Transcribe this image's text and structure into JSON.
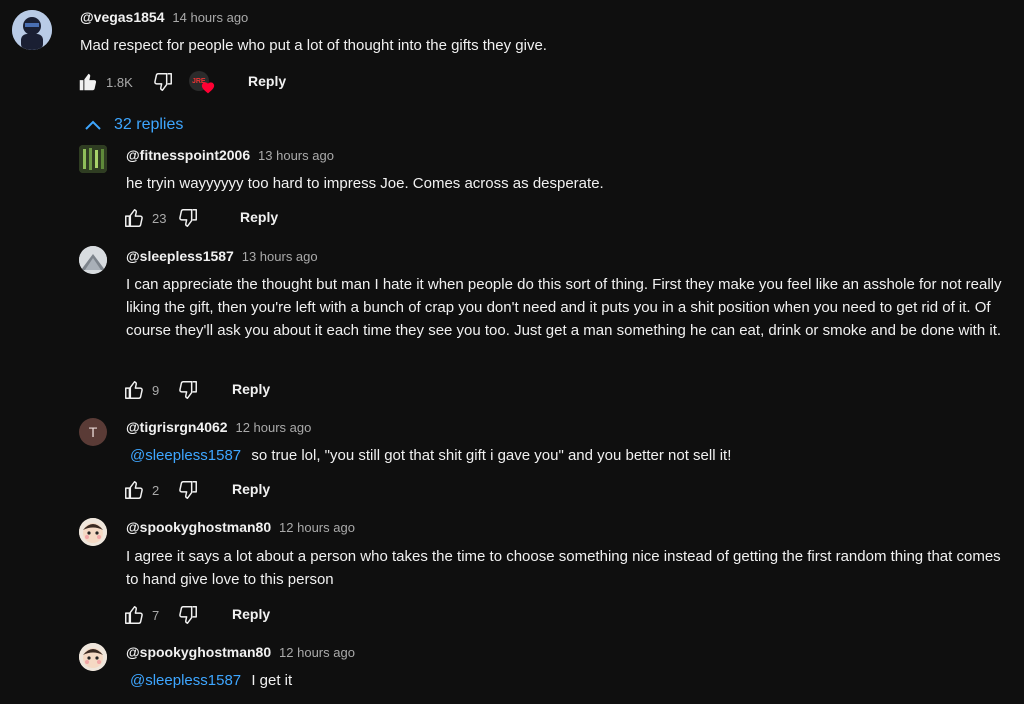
{
  "top_comment": {
    "author": "@vegas1854",
    "time": "14 hours ago",
    "text": "Mad respect for people who put a lot of thought into the gifts they give.",
    "likes": "1.8K",
    "reply_label": "Reply",
    "creator_heart_badge": "JRE"
  },
  "replies_toggle": {
    "label": "32 replies",
    "icon": "chevron-up-icon"
  },
  "replies": [
    {
      "author": "@fitnesspoint2006",
      "time": "13 hours ago",
      "text": "he tryin wayyyyyy too hard to impress Joe.  Comes across as desperate.",
      "likes": "23",
      "reply_label": "Reply"
    },
    {
      "author": "@sleepless1587",
      "time": "13 hours ago",
      "text": "I can appreciate the thought but man I hate it when people do this sort of thing. First they make you feel like an asshole for not really liking the gift, then you're left with a bunch of crap you don't need and it puts you in a shit position when you need to get rid of it. Of course they'll ask you about it each time they see you too. Just get a man something he can eat, drink or smoke and be done with it.",
      "likes": "9",
      "reply_label": "Reply"
    },
    {
      "author": "@tigrisrgn4062",
      "time": "12 hours ago",
      "avatar_letter": "T",
      "mention": "@sleepless1587",
      "text": "so true lol, \"you still got that shit gift i gave you\" and you better not sell it!",
      "likes": "2",
      "reply_label": "Reply"
    },
    {
      "author": "@spookyghostman80",
      "time": "12 hours ago",
      "text": "I agree it says a lot about a person who takes the time to choose something nice  instead of getting the first random thing that comes to hand give love to this person",
      "likes": "7",
      "reply_label": "Reply"
    },
    {
      "author": "@spookyghostman80",
      "time": "12 hours ago",
      "mention": "@sleepless1587",
      "text": "I get it"
    }
  ],
  "colors": {
    "background": "#0f0f0f",
    "text": "#f1f1f1",
    "secondary_text": "#aaaaaa",
    "link": "#3ea6ff",
    "heart": "#ff0033"
  }
}
